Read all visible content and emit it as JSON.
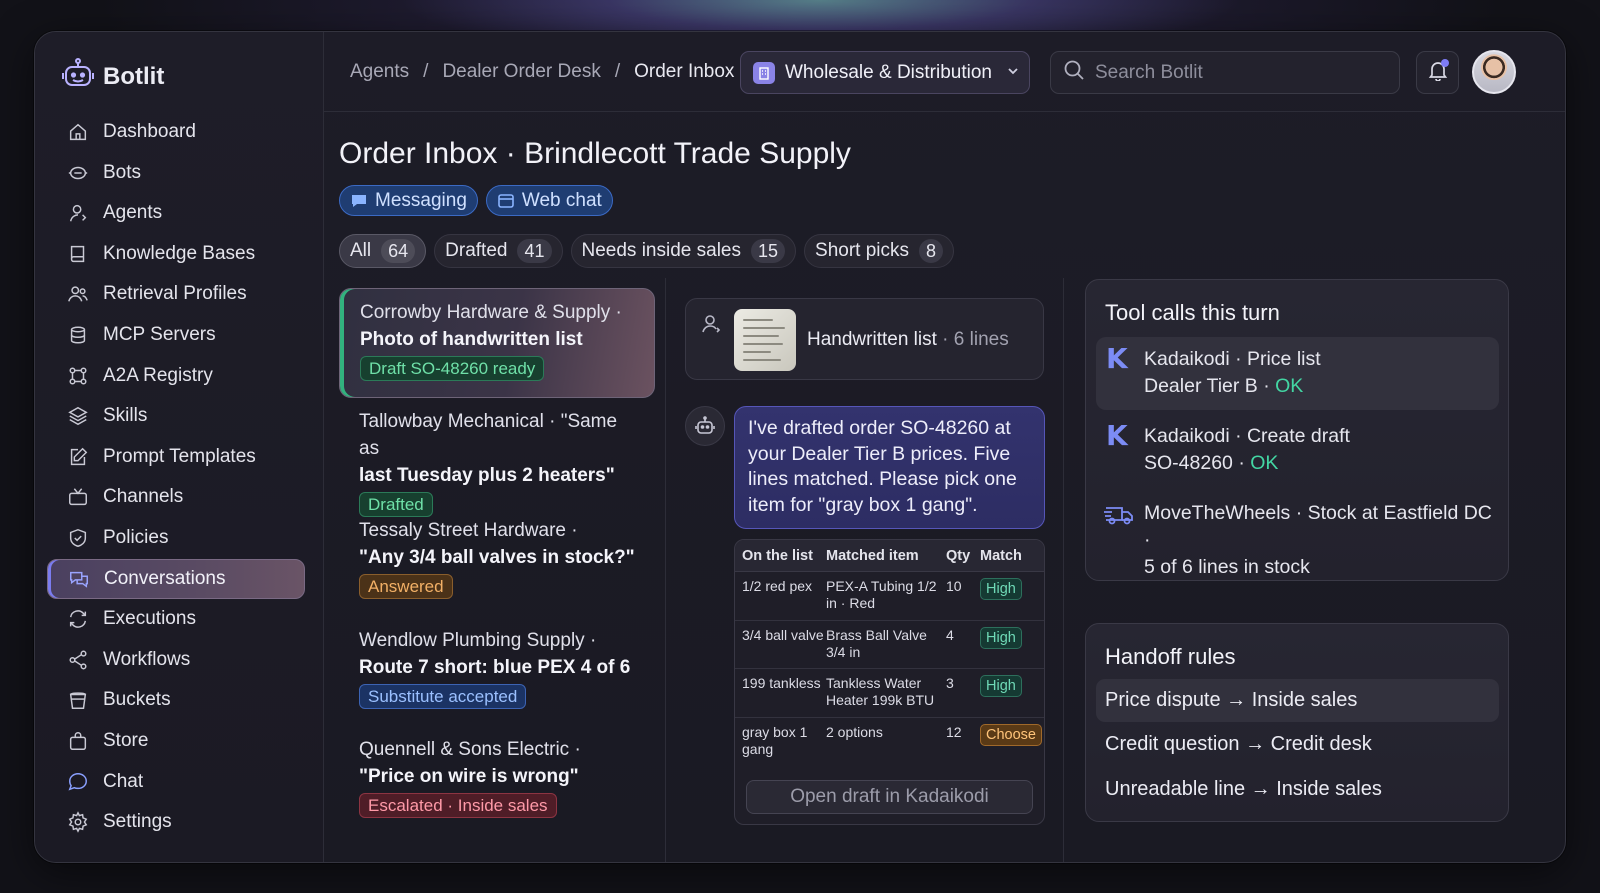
{
  "brand": {
    "name": "Botlit"
  },
  "sidebar": {
    "items": [
      {
        "label": "Dashboard",
        "icon": "home-icon"
      },
      {
        "label": "Bots",
        "icon": "bot-icon"
      },
      {
        "label": "Agents",
        "icon": "agents-icon"
      },
      {
        "label": "Knowledge Bases",
        "icon": "book-icon"
      },
      {
        "label": "Retrieval Profiles",
        "icon": "users-icon"
      },
      {
        "label": "MCP Servers",
        "icon": "database-icon"
      },
      {
        "label": "A2A Registry",
        "icon": "network-icon"
      },
      {
        "label": "Skills",
        "icon": "layers-icon"
      },
      {
        "label": "Prompt Templates",
        "icon": "edit-icon"
      },
      {
        "label": "Channels",
        "icon": "channels-icon"
      },
      {
        "label": "Policies",
        "icon": "shield-check-icon"
      },
      {
        "label": "Conversations",
        "icon": "chat-bubbles-icon",
        "active": true
      },
      {
        "label": "Executions",
        "icon": "refresh-icon"
      },
      {
        "label": "Workflows",
        "icon": "share-icon"
      },
      {
        "label": "Buckets",
        "icon": "bucket-icon"
      },
      {
        "label": "Store",
        "icon": "bag-icon"
      },
      {
        "label": "Chat",
        "icon": "chat-icon"
      },
      {
        "label": "Settings",
        "icon": "gear-icon"
      }
    ]
  },
  "header": {
    "breadcrumbs": [
      "Agents",
      "Dealer Order Desk",
      "Order Inbox"
    ],
    "workspace": "Wholesale & Distribution",
    "search_placeholder": "Search Botlit"
  },
  "main": {
    "title": "Order Inbox · Brindlecott Trade Supply",
    "channels": [
      "Messaging",
      "Web chat"
    ],
    "filters": [
      {
        "label": "All",
        "count": "64",
        "active": true
      },
      {
        "label": "Drafted",
        "count": "41"
      },
      {
        "label": "Needs inside sales",
        "count": "15"
      },
      {
        "label": "Short picks",
        "count": "8"
      }
    ]
  },
  "conversations": [
    {
      "line1": "Corrowby Hardware & Supply ·",
      "line2": "Photo of handwritten list",
      "badge": "Draft SO-48260 ready",
      "tone": "green"
    },
    {
      "line1": "Tallowbay Mechanical · \"Same as",
      "line2": "last Tuesday plus 2 heaters\"",
      "badge": "Drafted",
      "tone": "green"
    },
    {
      "line1": "Tessaly Street Hardware ·",
      "line2": "\"Any 3/4 ball valves in stock?\"",
      "badge": "Answered",
      "tone": "orange"
    },
    {
      "line1": "Wendlow Plumbing Supply ·",
      "line2": "Route 7 short: blue PEX 4 of 6",
      "badge": "Substitute accepted",
      "tone": "blue"
    },
    {
      "line1": "Quennell & Sons Electric ·",
      "line2": "\"Price on wire is wrong\"",
      "badge": "Escalated · Inside sales",
      "tone": "red"
    }
  ],
  "thread": {
    "attachment": {
      "name": "Handwritten list",
      "meta": "· 6 lines"
    },
    "bot_message": "I've drafted order SO-48260 at your Dealer Tier B prices. Five lines matched. Please pick one item for \"gray box 1 gang\".",
    "table": {
      "headers": [
        "On the list",
        "Matched item",
        "Qty",
        "Match"
      ],
      "rows": [
        {
          "list": "1/2 red pex",
          "item": "PEX-A Tubing 1/2 in · Red",
          "qty": "10",
          "match": "High"
        },
        {
          "list": "3/4 ball valve",
          "item": "Brass Ball Valve 3/4 in",
          "qty": "4",
          "match": "High"
        },
        {
          "list": "199 tankless",
          "item": "Tankless Water Heater 199k BTU",
          "qty": "3",
          "match": "High"
        },
        {
          "list": "gray box 1 gang",
          "item": "2 options",
          "qty": "12",
          "match": "Choose"
        }
      ]
    },
    "open_button": "Open draft in Kadaikodi"
  },
  "tool_calls": {
    "title": "Tool calls this turn",
    "items": [
      {
        "line1": "Kadaikodi · Price list",
        "line2": "Dealer Tier B",
        "status": "OK",
        "icon": "kadaikodi-icon"
      },
      {
        "line1": "Kadaikodi · Create draft",
        "line2": "SO-48260",
        "status": "OK",
        "icon": "kadaikodi-icon"
      },
      {
        "line1": "MoveTheWheels · Stock at Eastfield DC ·",
        "line2": "5 of 6 lines in stock",
        "status": "",
        "icon": "truck-icon"
      }
    ]
  },
  "handoff": {
    "title": "Handoff rules",
    "rules": [
      "Price dispute → Inside sales",
      "Credit question → Credit desk",
      "Unreadable line → Inside sales"
    ]
  },
  "colors": {
    "accent": "#7b7cf0",
    "ok": "#43d6a3",
    "active_bar": "#32b27e"
  }
}
